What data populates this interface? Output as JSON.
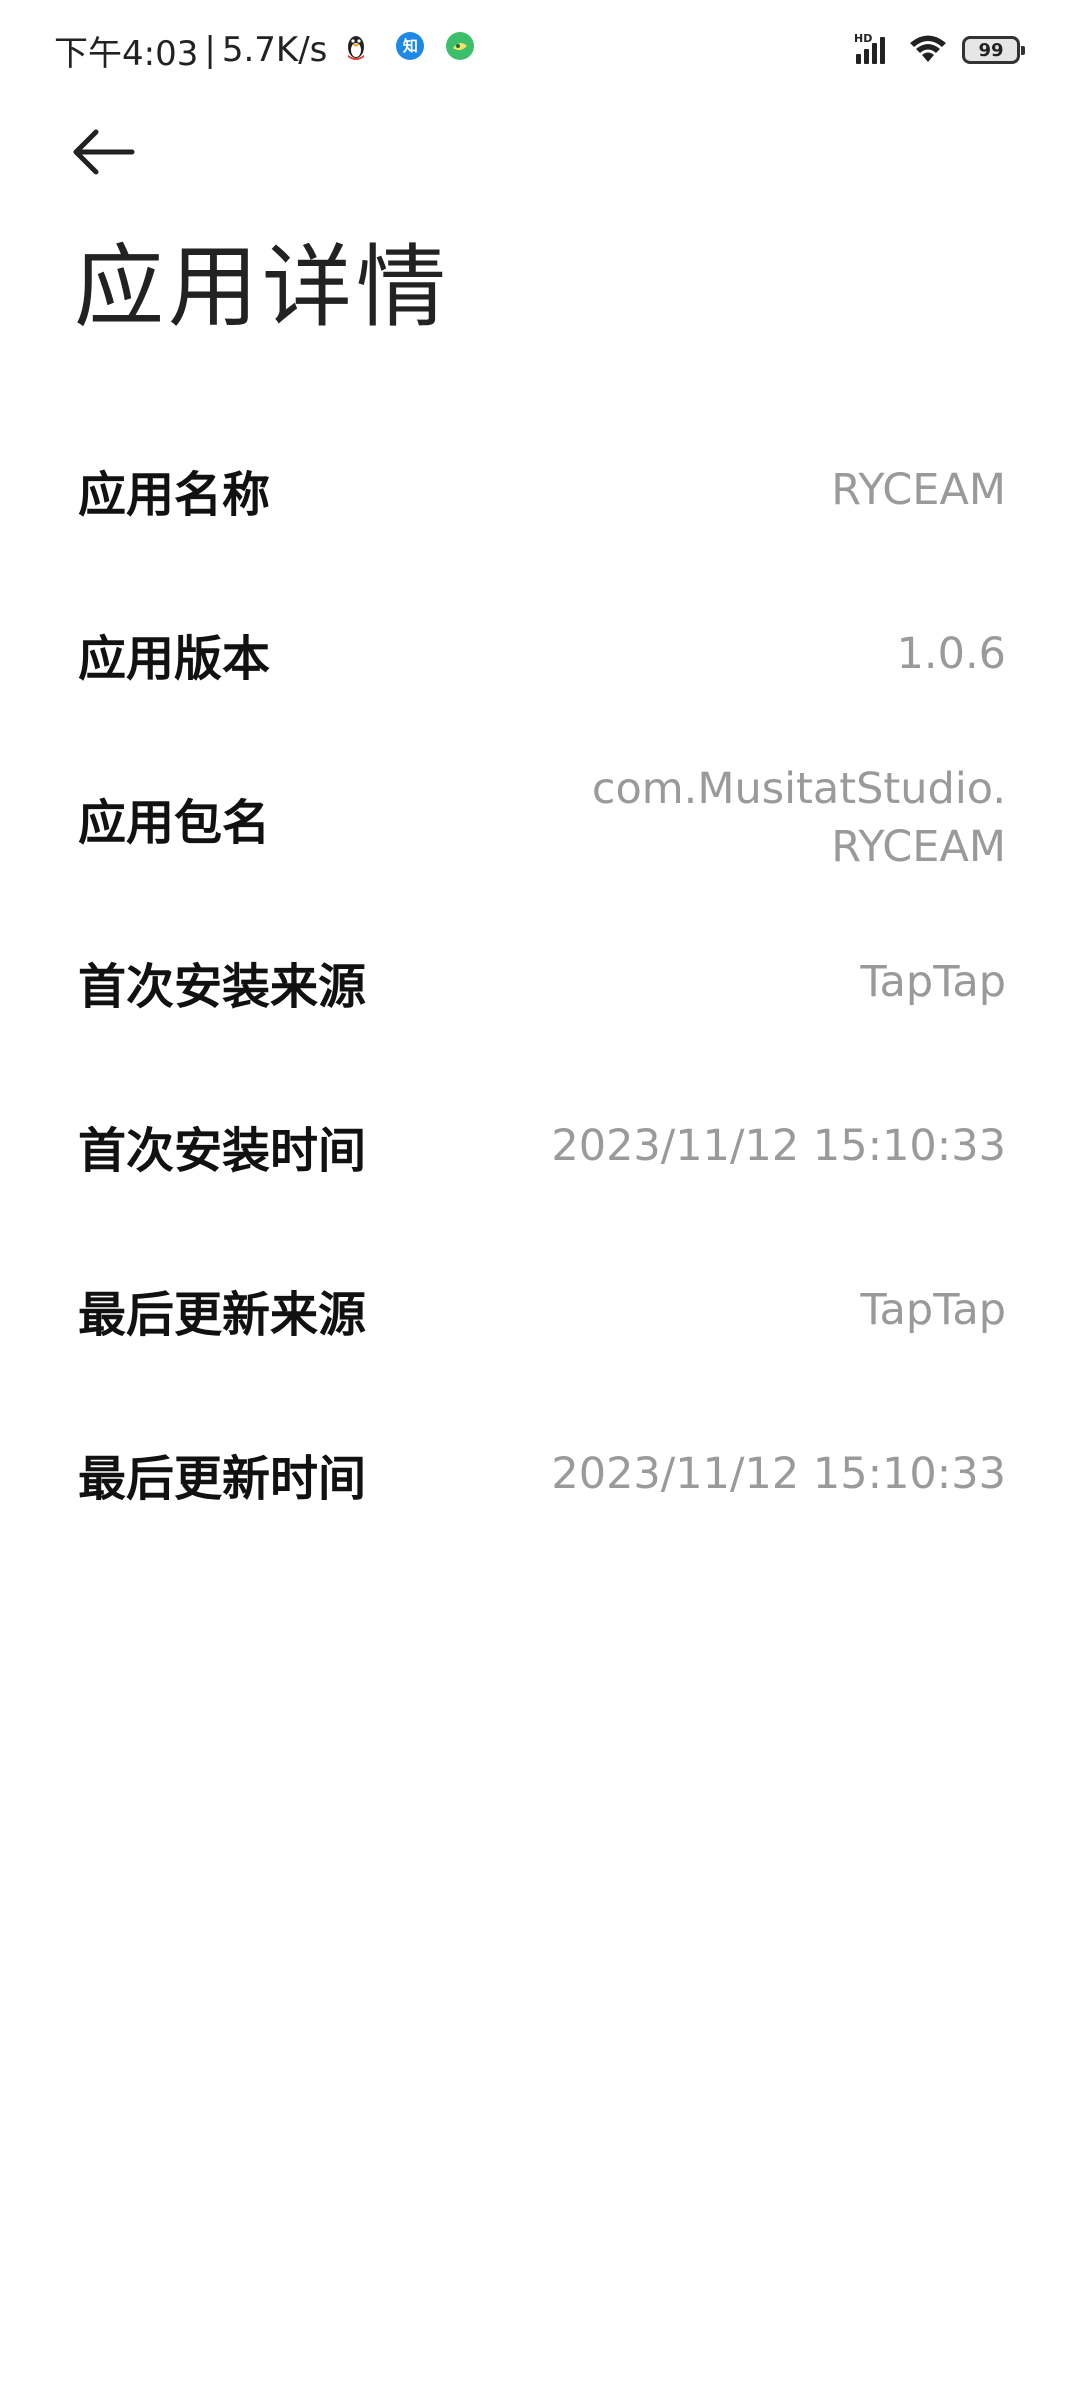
{
  "status_bar": {
    "time": "下午4:03",
    "separator": "|",
    "net_speed": "5.7K/s",
    "notification_icons": [
      "qq-penguin-icon",
      "zhihu-icon",
      "green-app-icon"
    ],
    "zhihu_glyph": "知",
    "signal_label": "HD",
    "battery_level": "99",
    "colors": {
      "zhihu": "#1e88e5",
      "green_app": "#3cbf6b"
    }
  },
  "header": {
    "back_icon": "arrow-left-icon",
    "title": "应用详情"
  },
  "details": [
    {
      "label": "应用名称",
      "value": "RYCEAM"
    },
    {
      "label": "应用版本",
      "value": "1.0.6"
    },
    {
      "label": "应用包名",
      "value": "com.MusitatStudio.RYCEAM"
    },
    {
      "label": "首次安装来源",
      "value": "TapTap"
    },
    {
      "label": "首次安装时间",
      "value": "2023/11/12 15:10:33"
    },
    {
      "label": "最后更新来源",
      "value": "TapTap"
    },
    {
      "label": "最后更新时间",
      "value": "2023/11/12 15:10:33"
    }
  ],
  "colors": {
    "label": "#111111",
    "value": "#9a9a9a",
    "background": "#ffffff"
  }
}
